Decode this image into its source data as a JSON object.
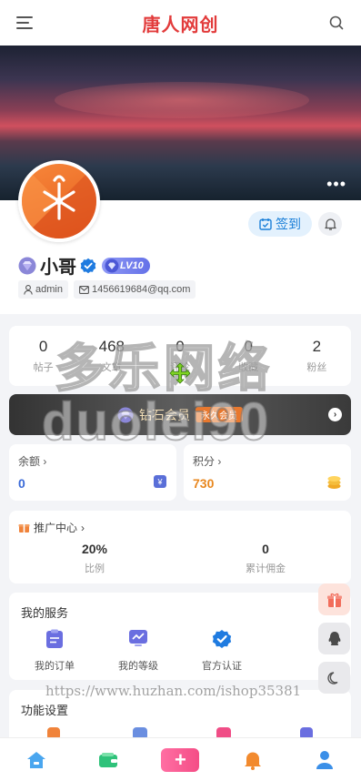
{
  "header": {
    "title": "唐人网创",
    "menu_icon": "hamburger-icon",
    "search_icon": "search-icon"
  },
  "banner": {
    "more_icon": "more-dots-icon"
  },
  "profile": {
    "name": "小哥",
    "level": "LV10",
    "checkin_label": "签到",
    "username": "admin",
    "email": "1456619684@qq.com"
  },
  "stats": [
    {
      "num": "0",
      "label": "帖子"
    },
    {
      "num": "468",
      "label": "文章"
    },
    {
      "num": "0",
      "label": "评论"
    },
    {
      "num": "0",
      "label": "收藏"
    },
    {
      "num": "2",
      "label": "粉丝"
    }
  ],
  "vip": {
    "label": "钻石会员",
    "badge": "永久会员"
  },
  "balance": {
    "title": "余额",
    "value": "0"
  },
  "points": {
    "title": "积分",
    "value": "730"
  },
  "promo": {
    "title": "推广中心",
    "cols": [
      {
        "value": "20%",
        "label": "比例"
      },
      {
        "value": "0",
        "label": "累计佣金"
      }
    ]
  },
  "services": {
    "title": "我的服务",
    "items": [
      {
        "label": "我的订单"
      },
      {
        "label": "我的等级"
      },
      {
        "label": "官方认证"
      }
    ]
  },
  "settings": {
    "title": "功能设置"
  },
  "watermark": {
    "line1": "多乐网络",
    "line2": "duolei90",
    "line3": "https://www.huzhan.com/ishop35381"
  },
  "colors": {
    "brand": "#e23b3b",
    "accent_blue": "#1a7fd8",
    "points": "#e8871e",
    "balance": "#3a6ad8"
  }
}
